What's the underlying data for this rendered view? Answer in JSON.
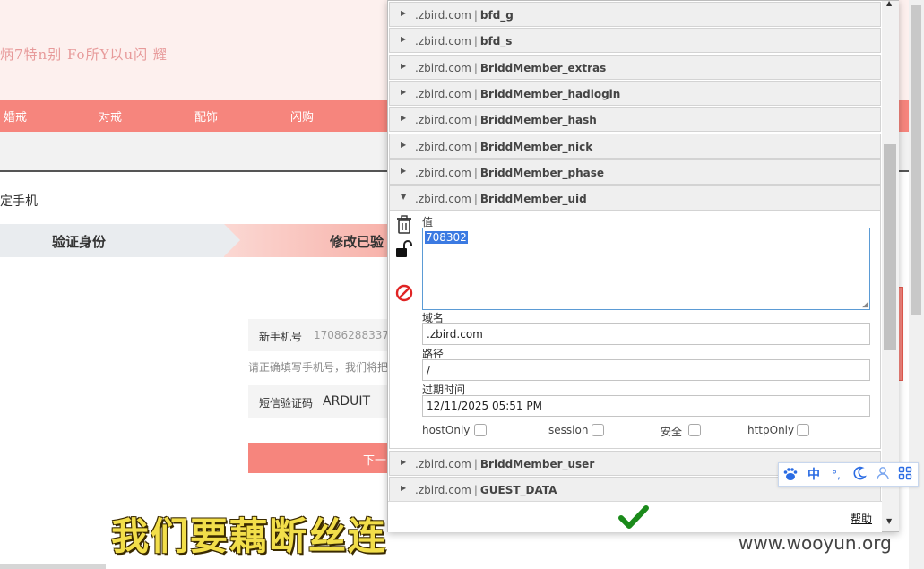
{
  "site": {
    "logo_text": "炳7特n别 Fo所Y以u闪 耀",
    "nav": [
      "婚戒",
      "对戒",
      "配饰",
      "闪购"
    ],
    "page_heading": "定手机",
    "steps": [
      "验证身份",
      "修改已验"
    ],
    "phone_label": "新手机号",
    "phone_value": "17086288337",
    "phone_hint": "请正确填写手机号，我们将把",
    "sms_label": "短信验证码",
    "sms_value": "ARDUIT",
    "next_button": "下一"
  },
  "cookie_editor": {
    "cookies_above": [
      {
        "domain": ".zbird.com",
        "name": "bfd_g"
      },
      {
        "domain": ".zbird.com",
        "name": "bfd_s"
      },
      {
        "domain": ".zbird.com",
        "name": "BriddMember_extras"
      },
      {
        "domain": ".zbird.com",
        "name": "BriddMember_hadlogin"
      },
      {
        "domain": ".zbird.com",
        "name": "BriddMember_hash"
      },
      {
        "domain": ".zbird.com",
        "name": "BriddMember_nick"
      },
      {
        "domain": ".zbird.com",
        "name": "BriddMember_phase"
      }
    ],
    "expanded": {
      "domain": ".zbird.com",
      "name": "BriddMember_uid",
      "value_label": "值",
      "value": "708302",
      "domain_label": "域名",
      "domain_value": ".zbird.com",
      "path_label": "路径",
      "path_value": "/",
      "expiry_label": "过期时间",
      "expiry_value": "12/11/2025 05:51 PM",
      "flags": [
        {
          "label": "hostOnly",
          "checked": false
        },
        {
          "label": "session",
          "checked": false
        },
        {
          "label": "安全",
          "checked": false
        },
        {
          "label": "httpOnly",
          "checked": false
        }
      ]
    },
    "cookies_below": [
      {
        "domain": ".zbird.com",
        "name": "BriddMember_user"
      },
      {
        "domain": ".zbird.com",
        "name": "GUEST_DATA"
      }
    ],
    "separator": "|",
    "help_label": "帮助",
    "icons": [
      "delete-icon",
      "unlock-icon",
      "block-icon",
      "save-checkmark-icon"
    ]
  },
  "ime_toolbar": {
    "mode": "中",
    "punct": "°,",
    "icons": [
      "paw-icon",
      "moon-icon",
      "user-icon",
      "grid-icon"
    ]
  },
  "overlay": {
    "subtitle": "我们要藕断丝连",
    "watermark": "www.wooyun.org"
  },
  "colors": {
    "accent": "#f6857d",
    "selection": "#3b7ae2",
    "check_green": "#1a8a1a",
    "block_red": "#e02424"
  }
}
